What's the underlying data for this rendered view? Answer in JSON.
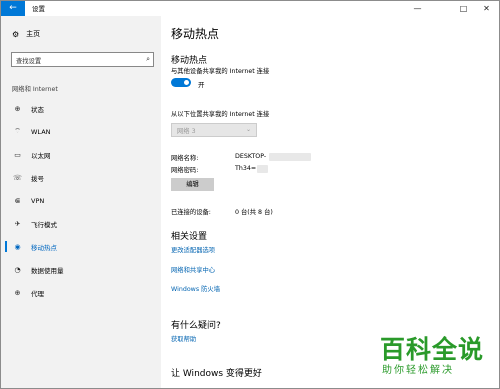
{
  "titlebar": {
    "back_glyph": "←",
    "app_title": "设置",
    "minimize_glyph": "—",
    "maximize_glyph": "□",
    "close_glyph": "✕"
  },
  "sidebar": {
    "home_label": "主页",
    "search_placeholder": "查找设置",
    "section_label": "网络和 Internet",
    "items": [
      {
        "label": "状态",
        "icon": "globe-icon",
        "glyph": "⊕"
      },
      {
        "label": "WLAN",
        "icon": "wifi-icon",
        "glyph": "⌔"
      },
      {
        "label": "以太网",
        "icon": "ethernet-icon",
        "glyph": "▭"
      },
      {
        "label": "拨号",
        "icon": "dialup-icon",
        "glyph": "☏"
      },
      {
        "label": "VPN",
        "icon": "vpn-icon",
        "glyph": "⋐"
      },
      {
        "label": "飞行模式",
        "icon": "airplane-icon",
        "glyph": "✈"
      },
      {
        "label": "移动热点",
        "icon": "hotspot-icon",
        "glyph": "◉",
        "active": true
      },
      {
        "label": "数据使用量",
        "icon": "data-usage-icon",
        "glyph": "◔"
      },
      {
        "label": "代理",
        "icon": "proxy-icon",
        "glyph": "⊕"
      }
    ]
  },
  "main": {
    "page_title": "移动热点",
    "hotspot": {
      "title": "移动热点",
      "description": "与其他设备共享我的 Internet 连接",
      "toggle_state": "开",
      "toggle_on": true
    },
    "share_from": {
      "label": "从以下位置共享我的 Internet 连接",
      "selected": "网络 3"
    },
    "network_name_label": "网络名称:",
    "network_name_value": "DESKTOP-",
    "network_password_label": "网络密码:",
    "network_password_value": "Th34=",
    "edit_button": "编辑",
    "connected_label": "已连接的设备:",
    "connected_value": "0 台(共 8 台)",
    "related": {
      "title": "相关设置",
      "links": [
        "更改适配器选项",
        "网络和共享中心",
        "Windows 防火墙"
      ]
    },
    "questions": {
      "title": "有什么疑问?",
      "link": "获取帮助"
    },
    "improve_title": "让 Windows 变得更好"
  },
  "watermark": {
    "main": "百科全说",
    "sub": "助你轻松解决"
  },
  "colors": {
    "accent": "#0078d7",
    "link": "#0063b1",
    "watermark": "#2a9a2a"
  }
}
